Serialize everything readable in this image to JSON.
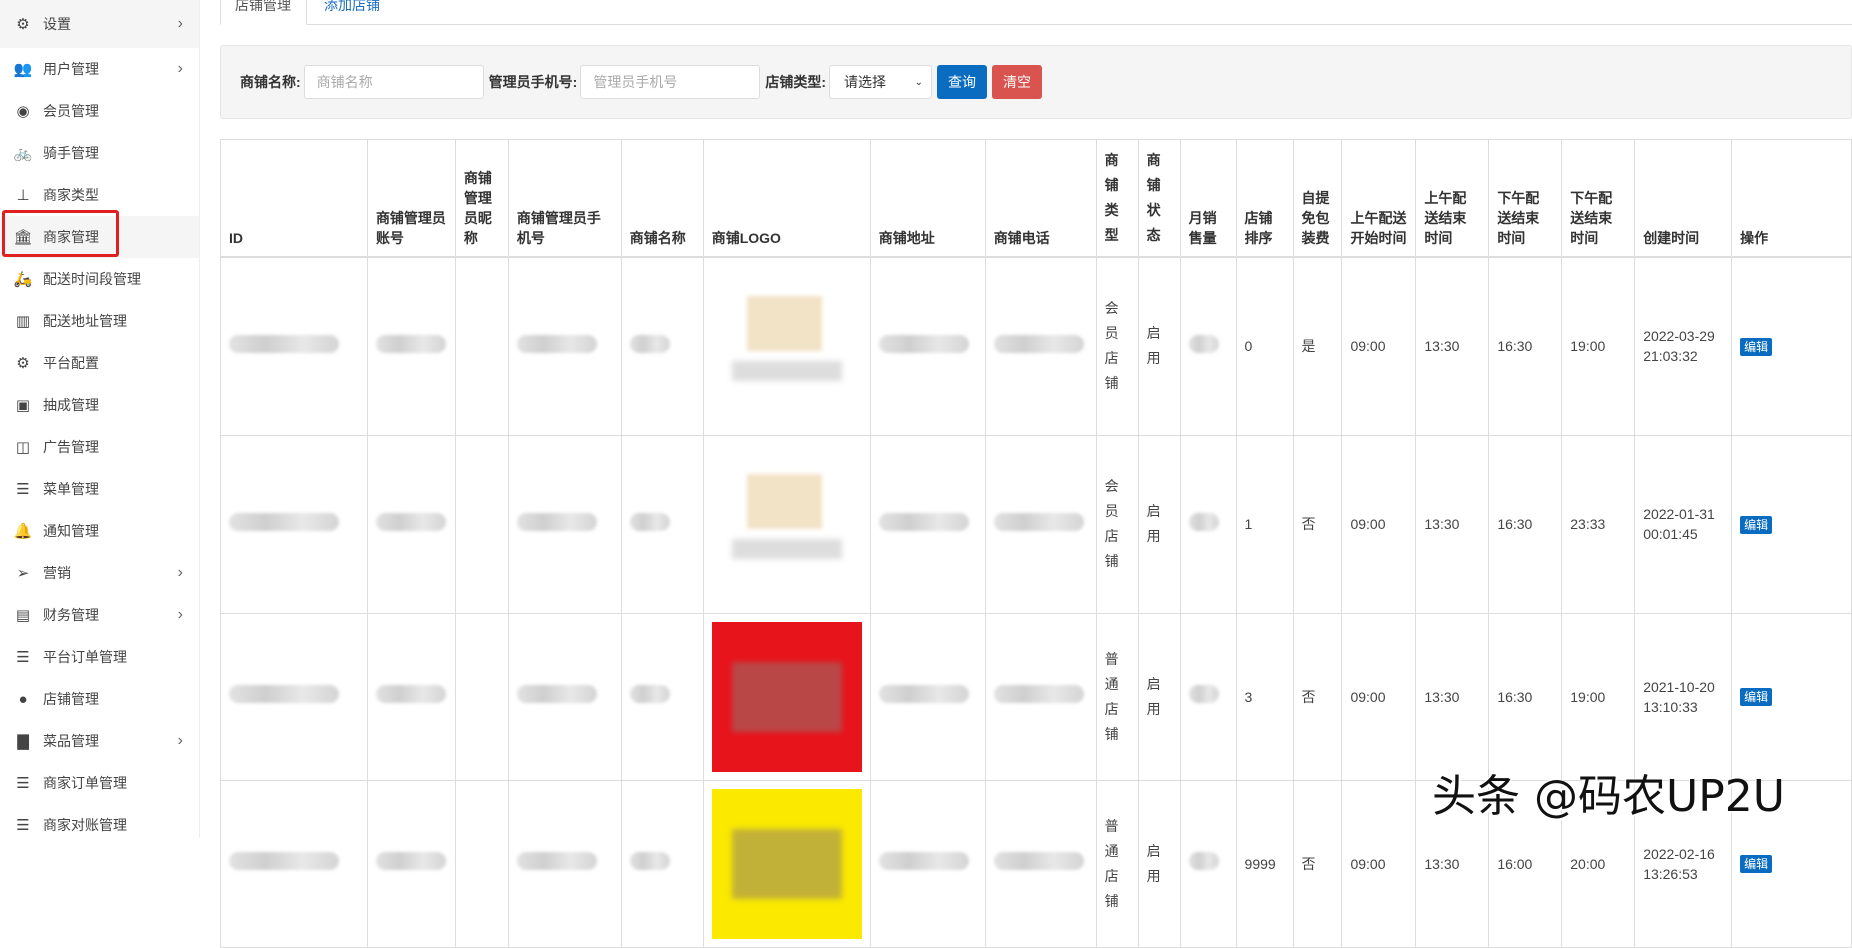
{
  "sidebar": {
    "items": [
      {
        "label": "设置",
        "icon": "gears-icon",
        "chev": true
      },
      {
        "label": "用户管理",
        "icon": "users-icon",
        "chev": true
      },
      {
        "label": "会员管理",
        "icon": "user-circle-icon"
      },
      {
        "label": "骑手管理",
        "icon": "bicycle-icon"
      },
      {
        "label": "商家类型",
        "icon": "sitemap-icon"
      },
      {
        "label": "商家管理",
        "icon": "bank-icon",
        "active": true
      },
      {
        "label": "配送时间段管理",
        "icon": "motorcycle-icon"
      },
      {
        "label": "配送地址管理",
        "icon": "map-icon"
      },
      {
        "label": "平台配置",
        "icon": "gear-icon"
      },
      {
        "label": "抽成管理",
        "icon": "money-icon"
      },
      {
        "label": "广告管理",
        "icon": "columns-icon"
      },
      {
        "label": "菜单管理",
        "icon": "bars-icon"
      },
      {
        "label": "通知管理",
        "icon": "bell-icon"
      },
      {
        "label": "营销",
        "icon": "paper-plane-icon",
        "chev": true
      },
      {
        "label": "财务管理",
        "icon": "book-icon",
        "chev": true
      },
      {
        "label": "平台订单管理",
        "icon": "bars-icon"
      },
      {
        "label": "店铺管理",
        "icon": "compass-icon"
      },
      {
        "label": "菜品管理",
        "icon": "file-icon",
        "chev": true
      },
      {
        "label": "商家订单管理",
        "icon": "bars-icon"
      },
      {
        "label": "商家对账管理",
        "icon": "bars-icon"
      }
    ]
  },
  "tabs": [
    "店铺管理",
    "添加店铺"
  ],
  "filter": {
    "name_label": "商铺名称:",
    "name_placeholder": "商铺名称",
    "phone_label": "管理员手机号:",
    "phone_placeholder": "管理员手机号",
    "type_label": "店铺类型:",
    "type_value": "请选择",
    "query": "查询",
    "clear": "清空"
  },
  "table": {
    "headers": [
      "ID",
      "商铺管理员账号",
      "商铺管理员昵称",
      "商铺管理员手机号",
      "商铺名称",
      "商铺LOGO",
      "商铺地址",
      "商铺电话",
      "商铺类型",
      "商铺状态",
      "月销售量",
      "店铺排序",
      "自提免包装费",
      "上午配送开始时间",
      "上午配送结束时间",
      "下午配送结束时间",
      "下午配送结束时间",
      "创建时间",
      "操作"
    ],
    "rows": [
      {
        "type": "会员店铺",
        "status": "启用",
        "sort": "0",
        "free": "是",
        "am_start": "09:00",
        "am_end": "13:30",
        "pm_start": "16:30",
        "pm_end": "19:00",
        "created": "2022-03-29 21:03:32",
        "action": "编辑",
        "logo_color": "#f2e2c6"
      },
      {
        "type": "会员店铺",
        "status": "启用",
        "sort": "1",
        "free": "否",
        "am_start": "09:00",
        "am_end": "13:30",
        "pm_start": "16:30",
        "pm_end": "23:33",
        "created": "2022-01-31 00:01:45",
        "action": "编辑",
        "logo_color": "#f2e2c6"
      },
      {
        "type": "普通店铺",
        "status": "启用",
        "sort": "3",
        "free": "否",
        "am_start": "09:00",
        "am_end": "13:30",
        "pm_start": "16:30",
        "pm_end": "19:00",
        "created": "2021-10-20 13:10:33",
        "action": "编辑",
        "logo_color": "#e8141c"
      },
      {
        "type": "普通店铺",
        "status": "启用",
        "sort": "9999",
        "free": "否",
        "am_start": "09:00",
        "am_end": "13:30",
        "pm_start": "16:00",
        "pm_end": "20:00",
        "created": "2022-02-16 13:26:53",
        "action": "编辑",
        "logo_color": "#fbe900"
      }
    ]
  },
  "watermark": "头条 @码农UP2U"
}
